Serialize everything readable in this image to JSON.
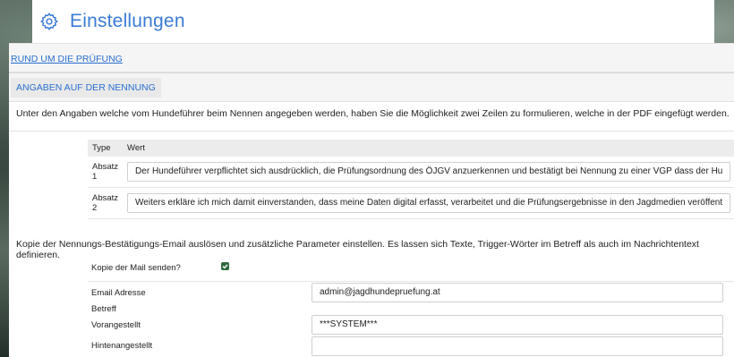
{
  "header": {
    "title": "Einstellungen",
    "icon": "gear-icon"
  },
  "sections": {
    "link_label": "RUND UM DIE PRÜFUNG",
    "tab_label": "ANGABEN AUF DER NENNUNG"
  },
  "intro_text": "Unter den Angaben welche vom Hundeführer beim Nennen angegeben werden, haben Sie die Möglichkeit zwei Zeilen zu formulieren, welche in der PDF eingefügt werden.",
  "table": {
    "col_type": "Type",
    "col_value": "Wert",
    "rows": [
      {
        "type": "Absatz 1",
        "value": "Der Hundeführer verpflichtet sich ausdrücklich, die Prüfungsordnung des ÖJGV anzuerkennen und bestätigt bei Nennung zu einer VGP  dass der Hu"
      },
      {
        "type": "Absatz 2",
        "value": "Weiters erkläre ich mich damit einverstanden, dass meine Daten digital erfasst, verarbeitet und die Prüfungsergebnisse in den Jagdmedien veröffent"
      }
    ]
  },
  "email_intro": "Kopie der Nennungs-Bestätigungs-Email auslösen und zusätzliche Parameter einstellen. Es lassen sich Texte, Trigger-Wörter im Betreff als auch im Nachrichtentext definieren.",
  "email": {
    "copy_label": "Kopie der Mail senden?",
    "copy_checked": true,
    "address_label": "Email Adresse",
    "address_value": "admin@jagdhundepruefung.at",
    "subject_label": "Betreff",
    "prefix_label": "Vorangestellt",
    "prefix_value": "***SYSTEM***",
    "suffix_label": "Hintenangestellt",
    "suffix_value": ""
  },
  "colors": {
    "accent": "#3a7bd5",
    "check": "#2e6b3f"
  }
}
